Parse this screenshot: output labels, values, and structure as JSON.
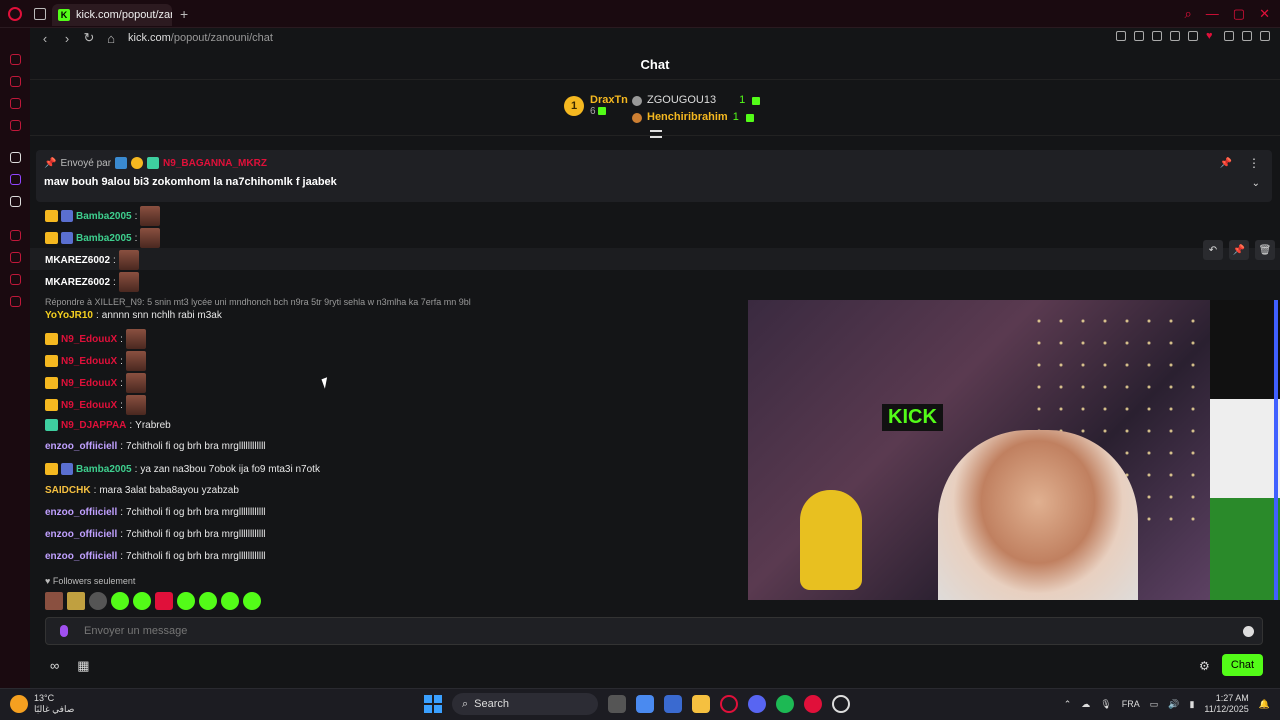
{
  "browser": {
    "tab_title": "kick.com/popout/zanouni",
    "url_domain": "kick.com",
    "url_path": "/popout/zanouni/chat",
    "new_tab": "+",
    "fav_letter": "K"
  },
  "header": {
    "title": "Chat"
  },
  "leaderboard": {
    "top": {
      "rank": "1",
      "name": "DraxTn",
      "count": "6"
    },
    "others": [
      {
        "name": "ZGOUGOU13",
        "count": "1"
      },
      {
        "name": "Henchiribrahim",
        "count": "1"
      }
    ]
  },
  "pinned": {
    "sent_by": "Envoyé par",
    "user": "N9_BAGANNA_MKRZ",
    "message": "maw bouh 9alou bi3 zokomhom la na7chihomlk f jaabek"
  },
  "messages": [
    {
      "user": "Bamba2005",
      "text": ""
    },
    {
      "user": "Bamba2005",
      "text": ""
    },
    {
      "user": "MKAREZ6002",
      "text": ""
    },
    {
      "user": "MKAREZ6002",
      "text": ""
    },
    {
      "reply": "Répondre à XILLER_N9: 5 snin mt3 lycée uni mndhonch bch n9ra 5tr 9ryti sehla w n3mlha ka 7erfa mn 9bl"
    },
    {
      "user": "YoYoJR10",
      "text": "annnn snn nchlh rabi m3ak"
    },
    {
      "user": "N9_EdouuX",
      "text": ""
    },
    {
      "user": "N9_EdouuX",
      "text": ""
    },
    {
      "user": "N9_EdouuX",
      "text": ""
    },
    {
      "user": "N9_EdouuX",
      "text": ""
    },
    {
      "user": "N9_DJAPPAA",
      "text": "Yrabreb"
    },
    {
      "user": "enzoo_offiiciell",
      "text": "7chitholi fi og brh bra mrgllllllllllll"
    },
    {
      "user": "Bamba2005",
      "text": "ya zan na3bou 7obok ija fo9 mta3i n7otk"
    },
    {
      "user": "SAIDCHK",
      "text": "mara 3alat baba8ayou yzabzab"
    },
    {
      "user": "enzoo_offiiciell",
      "text": "7chitholi fi og brh bra mrgllllllllllll"
    },
    {
      "user": "enzoo_offiiciell",
      "text": "7chitholi fi og brh bra mrgllllllllllll"
    },
    {
      "user": "enzoo_offiiciell",
      "text": "7chitholi fi og brh bra mrgllllllllllll"
    }
  ],
  "video": {
    "overlay_text": "KICK"
  },
  "followers_label": "Followers seulement",
  "input": {
    "placeholder": "Envoyer un message"
  },
  "send_button": "Chat",
  "taskbar": {
    "temp": "13°C",
    "weather_desc": "صافي غالبًا",
    "search": "Search",
    "lang": "FRA",
    "time": "1:27 AM",
    "date": "11/12/2025"
  },
  "colors": {
    "accent": "#53fc18",
    "brand_red": "#e0103a"
  }
}
